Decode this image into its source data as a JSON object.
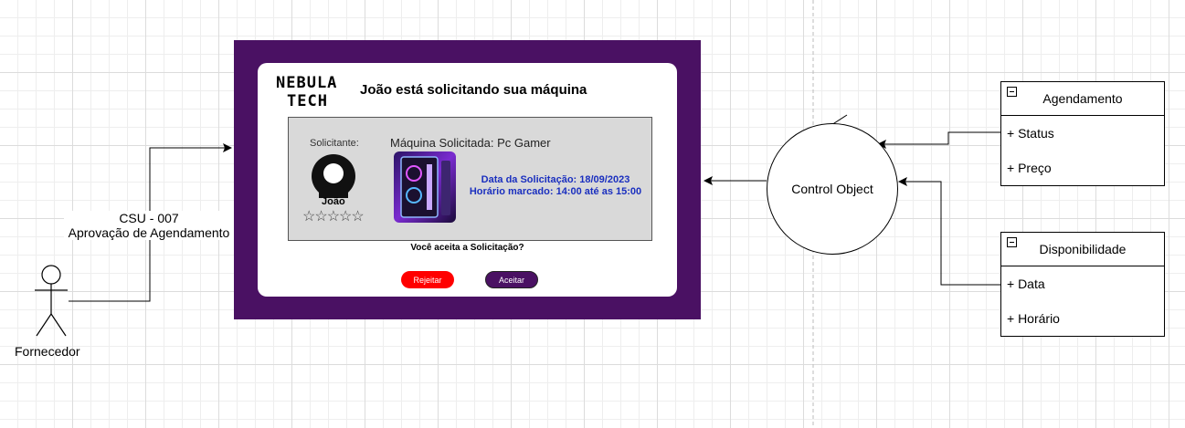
{
  "actor": {
    "name": "Fornecedor"
  },
  "use_case": {
    "code": "CSU - 007",
    "name": "Aprovação de Agendamento"
  },
  "control": {
    "label": "Control Object"
  },
  "classes": [
    {
      "title": "Agendamento",
      "attributes": [
        "+ Status",
        "+ Preço"
      ]
    },
    {
      "title": "Disponibilidade",
      "attributes": [
        "+ Data",
        "+ Horário"
      ]
    }
  ],
  "mockup": {
    "logo_line1": "NEBULA",
    "logo_line2": "TECH",
    "title": "João está solicitando sua máquina",
    "requester_label": "Solicitante:",
    "requester_name": "João",
    "rating_stars": "☆☆☆☆☆",
    "machine_label": "Máquina Solicitada: Pc Gamer",
    "request_date": "Data da Solicitação: 18/09/2023",
    "scheduled_time": "Horário marcado: 14:00 até as 15:00",
    "question": "Você aceita a Solicitação?",
    "reject_label": "Rejeitar",
    "accept_label": "Aceitar",
    "colors": {
      "frame": "#4a1163",
      "reject": "#ff0000",
      "accept": "#4a1163",
      "date_text": "#1a2fbf"
    }
  }
}
